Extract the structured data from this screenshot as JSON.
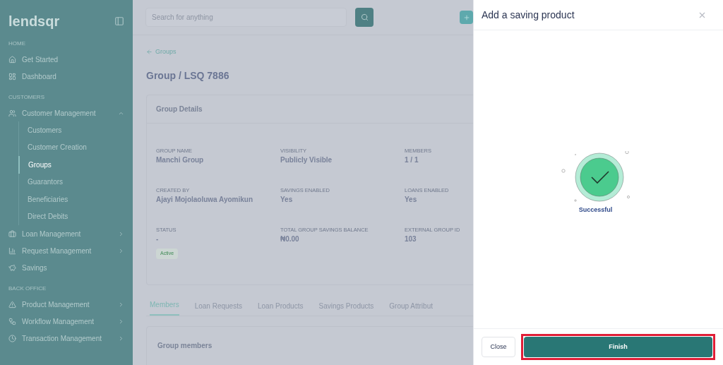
{
  "sidebar": {
    "logo": "lendsqr",
    "sections": [
      {
        "title": "HOME",
        "items": [
          {
            "label": "Get Started",
            "selected": false
          },
          {
            "label": "Dashboard",
            "selected": false
          }
        ]
      },
      {
        "title": "CUSTOMERS",
        "items": [
          {
            "label": "Customer Management",
            "selected": false,
            "expanded": true,
            "children": [
              {
                "label": "Customers",
                "selected": false
              },
              {
                "label": "Customer Creation",
                "selected": false
              },
              {
                "label": "Groups",
                "selected": true
              },
              {
                "label": "Guarantors",
                "selected": false
              },
              {
                "label": "Beneficiaries",
                "selected": false
              },
              {
                "label": "Direct Debits",
                "selected": false
              }
            ]
          },
          {
            "label": "Loan Management",
            "selected": false,
            "expanded": false
          },
          {
            "label": "Request Management",
            "selected": false,
            "expanded": false
          },
          {
            "label": "Savings",
            "selected": false
          }
        ]
      },
      {
        "title": "BACK OFFICE",
        "items": [
          {
            "label": "Product Management",
            "selected": false,
            "expanded": false
          },
          {
            "label": "Workflow Management",
            "selected": false,
            "expanded": false
          },
          {
            "label": "Transaction Management",
            "selected": false,
            "expanded": false
          }
        ]
      }
    ]
  },
  "search": {
    "placeholder": "Search for anything"
  },
  "back_link": "Groups",
  "page_title": "Group / LSQ 7886",
  "details": {
    "title": "Group Details",
    "fields": [
      {
        "label": "GROUP NAME",
        "value": "Manchi Group"
      },
      {
        "label": "VISIBILITY",
        "value": "Publicly Visible"
      },
      {
        "label": "MEMBERS",
        "value": "1 / 1"
      },
      {
        "label": "CREATED BY",
        "value": "Ajayi Mojolaoluwa Ayomikun"
      },
      {
        "label": "SAVINGS ENABLED",
        "value": "Yes"
      },
      {
        "label": "LOANS ENABLED",
        "value": "Yes"
      },
      {
        "label": "STATUS",
        "value": "-",
        "badge": "Active"
      },
      {
        "label": "TOTAL GROUP SAVINGS BALANCE",
        "value": "₦0.00"
      },
      {
        "label": "EXTERNAL GROUP ID",
        "value": "103"
      }
    ]
  },
  "tabs": [
    {
      "label": "Members",
      "selected": true
    },
    {
      "label": "Loan Requests",
      "selected": false
    },
    {
      "label": "Loan Products",
      "selected": false
    },
    {
      "label": "Savings Products",
      "selected": false
    },
    {
      "label": "Group Attribut",
      "selected": false
    }
  ],
  "members_card": {
    "title": "Group members"
  },
  "drawer": {
    "title": "Add a saving product",
    "status": "Successful",
    "buttons": [
      {
        "label": "Close",
        "kind": "secondary"
      },
      {
        "label": "Finish",
        "kind": "primary",
        "highlighted": true
      }
    ]
  }
}
